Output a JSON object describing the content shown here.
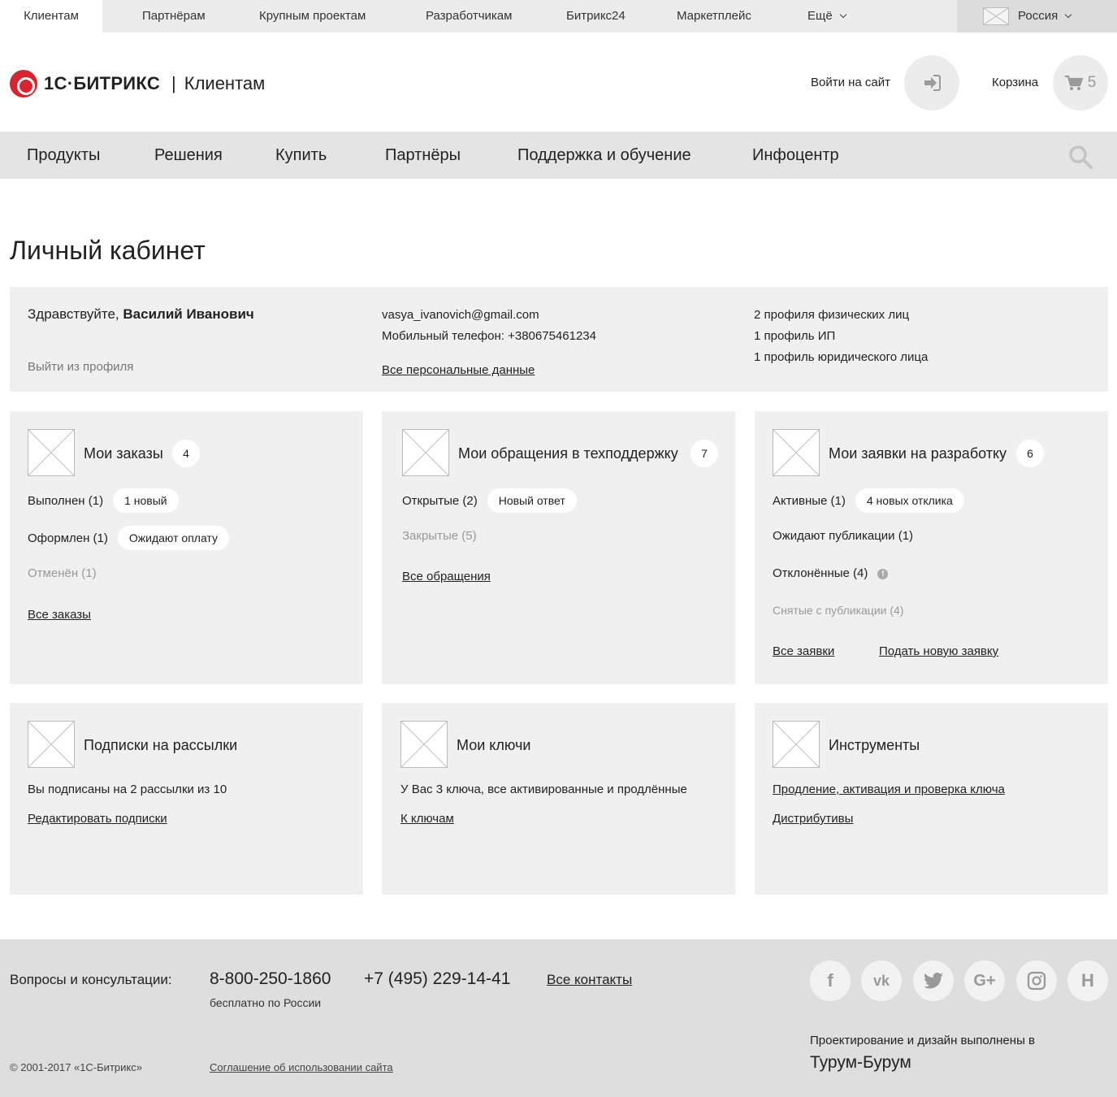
{
  "topbar": {
    "tabs": [
      "Клиентам",
      "Партнёрам",
      "Крупным проектам",
      "Разработчикам",
      "Битрикс24",
      "Маркетплейс",
      "Ещё"
    ],
    "region": "Россия"
  },
  "header": {
    "logo_text": "1С·БИТРИКС",
    "separator": "|",
    "logo_sub": "Клиентам",
    "login_label": "Войти на сайт",
    "cart_label": "Корзина",
    "cart_count": "5"
  },
  "nav": {
    "items": [
      "Продукты",
      "Решения",
      "Купить",
      "Партнёры",
      "Поддержка и обучение",
      "Инфоцентр"
    ]
  },
  "page_title": "Личный кабинет",
  "profile": {
    "greeting": "Здравствуйте,",
    "name": "Василий Иванович",
    "logout": "Выйти из профиля",
    "email": "vasya_ivanovich@gmail.com",
    "phone": "Мобильный телефон: +380675461234",
    "personal_link": "Все персональные данные",
    "profiles": [
      "2 профиля физических лиц",
      "1 профиль ИП",
      "1 профиль юридического лица"
    ]
  },
  "cards": {
    "orders": {
      "title": "Мои заказы",
      "count": "4",
      "done": "Выполнен (1)",
      "done_pill": "1 новый",
      "placed": "Оформлен (1)",
      "placed_pill": "Ожидают оплату",
      "cancelled": "Отменён (1)",
      "link": "Все заказы"
    },
    "support": {
      "title": "Мои обращения в техподдержку",
      "count": "7",
      "open": "Открытые (2)",
      "open_pill": "Новый ответ",
      "closed": "Закрытые (5)",
      "link": "Все обращения"
    },
    "dev": {
      "title": "Мои заявки на разработку",
      "count": "6",
      "active": "Активные (1)",
      "active_pill": "4 новых отклика",
      "waiting": "Ожидают публикации (1)",
      "rejected": "Отклонённые (4)",
      "withdrawn": "Снятые с публикации (4)",
      "link_all": "Все заявки",
      "link_new": "Подать новую заявку"
    },
    "subs": {
      "title": "Подписки на рассылки",
      "text": "Вы подписаны на 2 рассылки из 10",
      "link": "Редактировать подписки"
    },
    "keys": {
      "title": "Мои ключи",
      "text": "У Вас 3 ключа, все активированные и продлённые",
      "link": "К ключам"
    },
    "tools": {
      "title": "Инструменты",
      "link1": "Продление, активация и проверка ключа",
      "link2": "Дистрибутивы"
    }
  },
  "footer": {
    "questions": "Вопросы и консультации:",
    "phone1": "8-800-250-1860",
    "phone1_note": "бесплатно по России",
    "phone2": "+7 (495) 229-14-41",
    "contacts": "Все контакты",
    "social": [
      "f",
      "vk",
      "twitter",
      "G+",
      "instagram",
      "H"
    ],
    "copyright": "© 2001-2017  «1С-Битрикс»",
    "agreement": "Соглашение об использовании сайта",
    "design_note": "Проектирование и дизайн выполнены в",
    "studio": "Турум-Бурум"
  }
}
